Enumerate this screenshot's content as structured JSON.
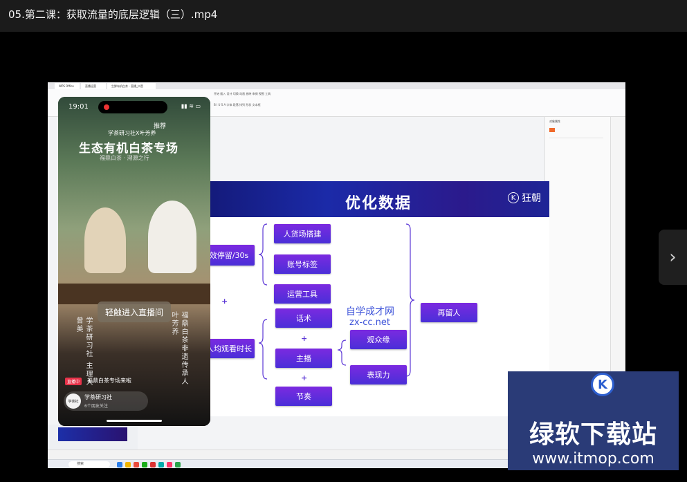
{
  "player": {
    "title": "05.第二课：获取流量的底层逻辑（三）.mp4",
    "next_icon": "chevron-right-icon"
  },
  "browser": {
    "tabs": [
      "WPS Office",
      "直播运营",
      "生鲜有机白茶 - 直播_抖音",
      "Phone - AirDroid Cast"
    ],
    "right_panel_title": "对象属性",
    "taskbar_search": "搜索"
  },
  "slide": {
    "title": "优化数据",
    "brand": "狂朝",
    "left_nodes": [
      "效停留/30s",
      "人均观看时长"
    ],
    "group1": [
      "人货场搭建",
      "账号标签",
      "运营工具"
    ],
    "group2": [
      "话术",
      "主播",
      "节奏"
    ],
    "group3": [
      "观众缘",
      "表现力"
    ],
    "result": "再留人",
    "plus": "+",
    "watermark_line1": "自学成才网",
    "watermark_line2": "zx-cc.net"
  },
  "phone": {
    "time": "19:01",
    "tab": "推荐",
    "promo_sub": "学茶研习社X叶芳养",
    "promo_title": "生态有机白茶专场",
    "promo_tagline": "福鼎白茶 · 溯源之行",
    "enter_button": "轻触进入直播间",
    "host_left_name": "曾美",
    "host_left_role": "学茶研习社 主理人",
    "host_right_name": "叶芳养",
    "host_right_role": "福鼎白茶非遗传承人",
    "live_badge": "直播中",
    "live_topic": "福鼎白茶专场来啦",
    "account_name": "学茶研习社",
    "account_sub": "6个朋友关注",
    "account_avatar_text": "学茶社"
  },
  "overlay_watermark": {
    "main": "绿软下载站",
    "url": "www.itmop.com"
  }
}
